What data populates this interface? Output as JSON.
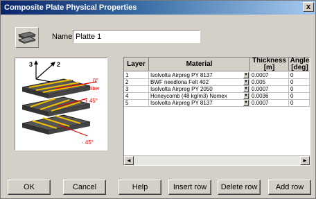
{
  "window": {
    "title": "Composite Plate Physical Properties",
    "close_label": "x"
  },
  "name_field": {
    "label": "Name",
    "value": "Platte 1"
  },
  "diagram": {
    "axis_labels": [
      "3",
      "2",
      "1"
    ],
    "angle_labels": [
      "0°",
      "fiber",
      "+ 45°",
      "- 45°"
    ]
  },
  "table": {
    "headers": {
      "layer": "Layer",
      "material": "Material",
      "thickness_line1": "Thickness",
      "thickness_line2": "[m]",
      "angle_line1": "Angle",
      "angle_line2": "[deg]"
    },
    "rows": [
      {
        "layer": "1",
        "material": "Isolvolta Airpreg PY 8137",
        "thickness": "0.0007",
        "angle": "0"
      },
      {
        "layer": "2",
        "material": "BWF needlona Felt 402",
        "thickness": "0.005",
        "angle": "0"
      },
      {
        "layer": "3",
        "material": "Isolvolta Airpreg PY 2050",
        "thickness": "0.0007",
        "angle": "0"
      },
      {
        "layer": "4",
        "material": "Honeycomb (48 kg/m3) Nomex",
        "thickness": "0.0036",
        "angle": "0"
      },
      {
        "layer": "5",
        "material": "Isolvolta Airpreg PY 8137",
        "thickness": "0.0007",
        "angle": "0"
      }
    ],
    "dropdown_glyph": "▼",
    "scroll_left": "◄",
    "scroll_right": "►"
  },
  "buttons": {
    "ok": "OK",
    "cancel": "Cancel",
    "help": "Help",
    "insert_row": "Insert row",
    "delete_row": "Delete row",
    "add_row": "Add row"
  }
}
